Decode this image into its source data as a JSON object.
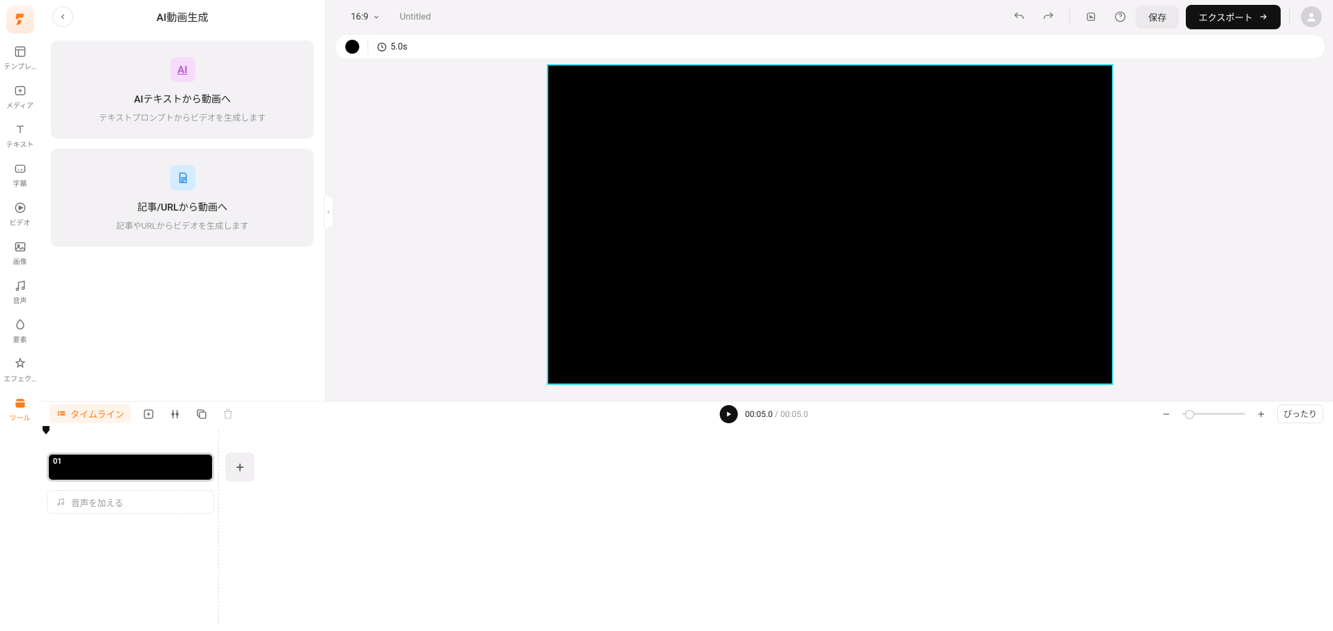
{
  "rail": {
    "items": [
      {
        "label": "テンプレ…"
      },
      {
        "label": "メディア"
      },
      {
        "label": "テキスト"
      },
      {
        "label": "字幕"
      },
      {
        "label": "ビデオ"
      },
      {
        "label": "画像"
      },
      {
        "label": "音声"
      },
      {
        "label": "要素"
      },
      {
        "label": "エフェク…"
      },
      {
        "label": "ツール"
      }
    ]
  },
  "panel": {
    "title": "AI動画生成",
    "card1_title": "AIテキストから動画へ",
    "card1_sub": "テキストプロンプトからビデオを生成します",
    "card2_title": "記事/URLから動画へ",
    "card2_sub": "記事やURLからビデオを生成します"
  },
  "top": {
    "ratio": "16:9",
    "project_title": "Untitled",
    "save": "保存",
    "export": "エクスポート"
  },
  "strip": {
    "duration": "5.0s"
  },
  "play": {
    "timeline_label": "タイムライン",
    "current": "00:05.0",
    "total": "00:05.0",
    "fit": "ぴったり"
  },
  "timeline": {
    "clip_number": "01",
    "add_audio": "音声を加える"
  }
}
